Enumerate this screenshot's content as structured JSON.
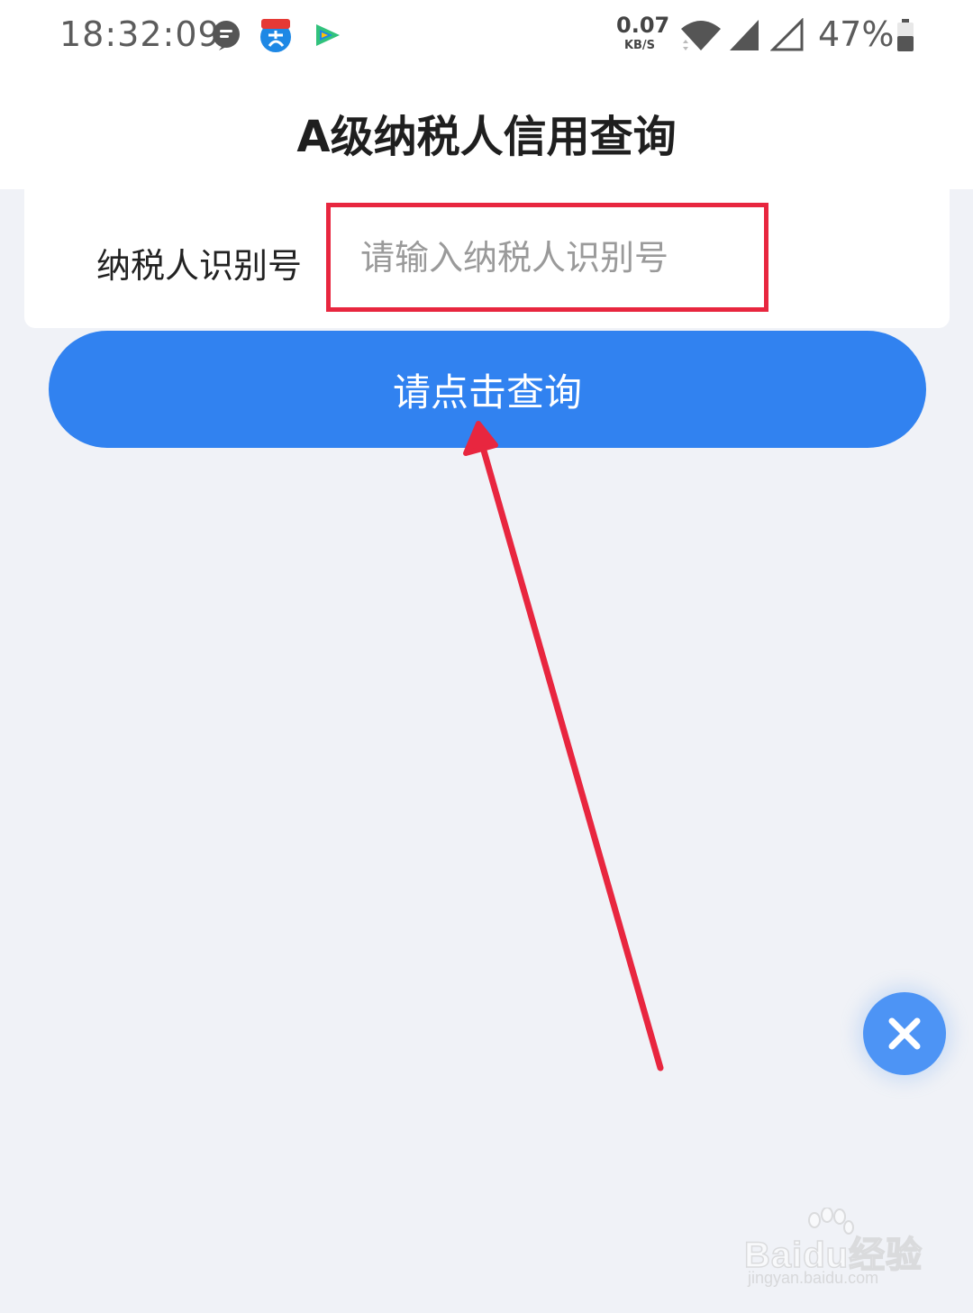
{
  "status_bar": {
    "time": "18:32:09",
    "notification_icons": [
      "chat-bubble-icon",
      "alipay-icon",
      "tencent-video-icon"
    ],
    "net_speed_value": "0.07",
    "net_speed_unit": "KB/S",
    "battery_percent": "47%"
  },
  "header": {
    "title": "A级纳税人信用查询"
  },
  "form": {
    "taxpayer_id_label": "纳税人识别号",
    "taxpayer_id_placeholder": "请输入纳税人识别号",
    "taxpayer_id_value": ""
  },
  "query_button": {
    "label": "请点击查询"
  },
  "annotation": {
    "color": "#e8263f"
  },
  "colors": {
    "accent": "#3182f0",
    "background": "#f0f2f7",
    "close_fab": "#4d94f5"
  },
  "watermark": {
    "logo_text": "Baidu经验",
    "url": "jingyan.baidu.com"
  }
}
